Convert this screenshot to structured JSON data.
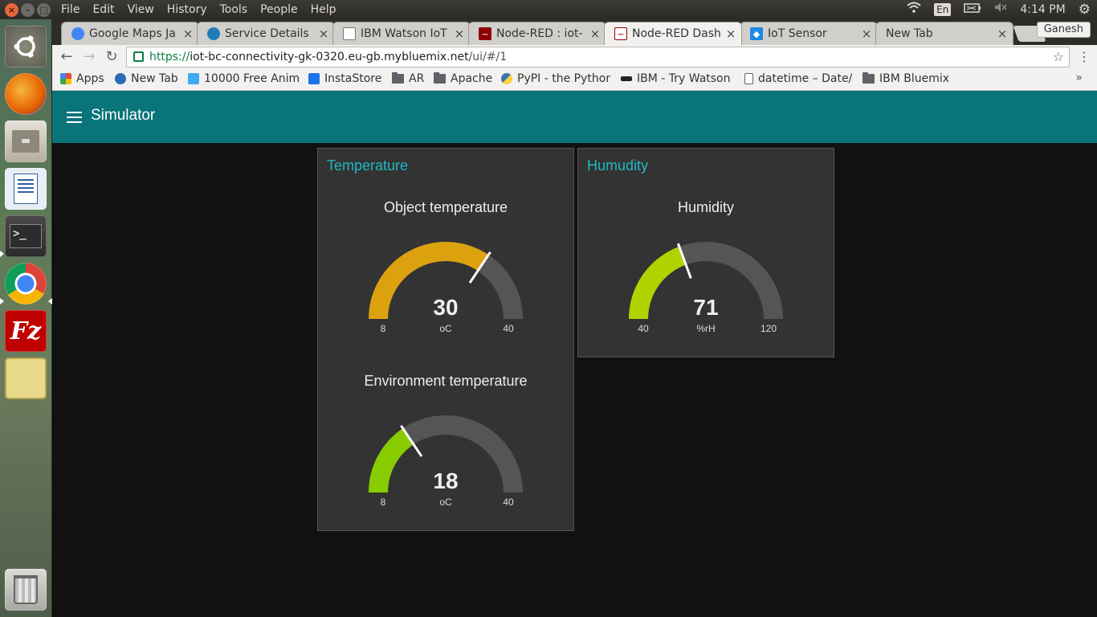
{
  "os": {
    "menu": [
      "File",
      "Edit",
      "View",
      "History",
      "Tools",
      "People",
      "Help"
    ],
    "tray": {
      "keyboard": "En",
      "time": "4:14 PM"
    }
  },
  "browser": {
    "tabs": [
      {
        "title": "Google Maps Ja",
        "icon": "google-maps-icon",
        "color": "#4285f4"
      },
      {
        "title": "Service Details",
        "icon": "service-details-icon",
        "color": "#1e7db9"
      },
      {
        "title": "IBM Watson IoT",
        "icon": "page-icon",
        "color": "#888888"
      },
      {
        "title": "Node-RED : iot-",
        "icon": "node-red-icon",
        "color": "#8f0000"
      },
      {
        "title": "Node-RED Dash",
        "icon": "node-red-icon",
        "color": "#8f0000"
      },
      {
        "title": "IoT Sensor",
        "icon": "iot-sensor-icon",
        "color": "#1e88e5"
      },
      {
        "title": "New Tab",
        "icon": "",
        "color": ""
      }
    ],
    "active_tab": 4,
    "profile": "Ganesh",
    "url": {
      "scheme": "https://",
      "host": "iot-bc-connectivity-gk-0320.eu-gb.mybluemix.net",
      "path": "/ui/#/1"
    },
    "bookmarks": [
      {
        "label": "Apps",
        "type": "apps"
      },
      {
        "label": "New Tab",
        "type": "site"
      },
      {
        "label": "10000 Free Anim",
        "type": "site"
      },
      {
        "label": "InstaStore",
        "type": "site"
      },
      {
        "label": "AR",
        "type": "folder"
      },
      {
        "label": "Apache",
        "type": "folder"
      },
      {
        "label": "PyPI - the Python",
        "type": "site"
      },
      {
        "label": "IBM - Try Watson",
        "type": "site"
      },
      {
        "label": "datetime – Date/",
        "type": "page"
      },
      {
        "label": "IBM Bluemix",
        "type": "folder"
      }
    ],
    "bookmarks_overflow": "»"
  },
  "dashboard": {
    "title": "Simulator",
    "accent": "#097479",
    "groups": [
      {
        "title": "Temperature",
        "gauges": [
          {
            "label": "Object temperature",
            "value": 30,
            "unit": "oC",
            "min": 8,
            "max": 40,
            "color": "#dca10f"
          },
          {
            "label": "Environment temperature",
            "value": 18,
            "unit": "oC",
            "min": 8,
            "max": 40,
            "color": "#88cc00"
          }
        ]
      },
      {
        "title": "Humudity",
        "gauges": [
          {
            "label": "Humidity",
            "value": 71,
            "unit": "%rH",
            "min": 40,
            "max": 120,
            "color": "#b0d300"
          }
        ]
      }
    ]
  }
}
